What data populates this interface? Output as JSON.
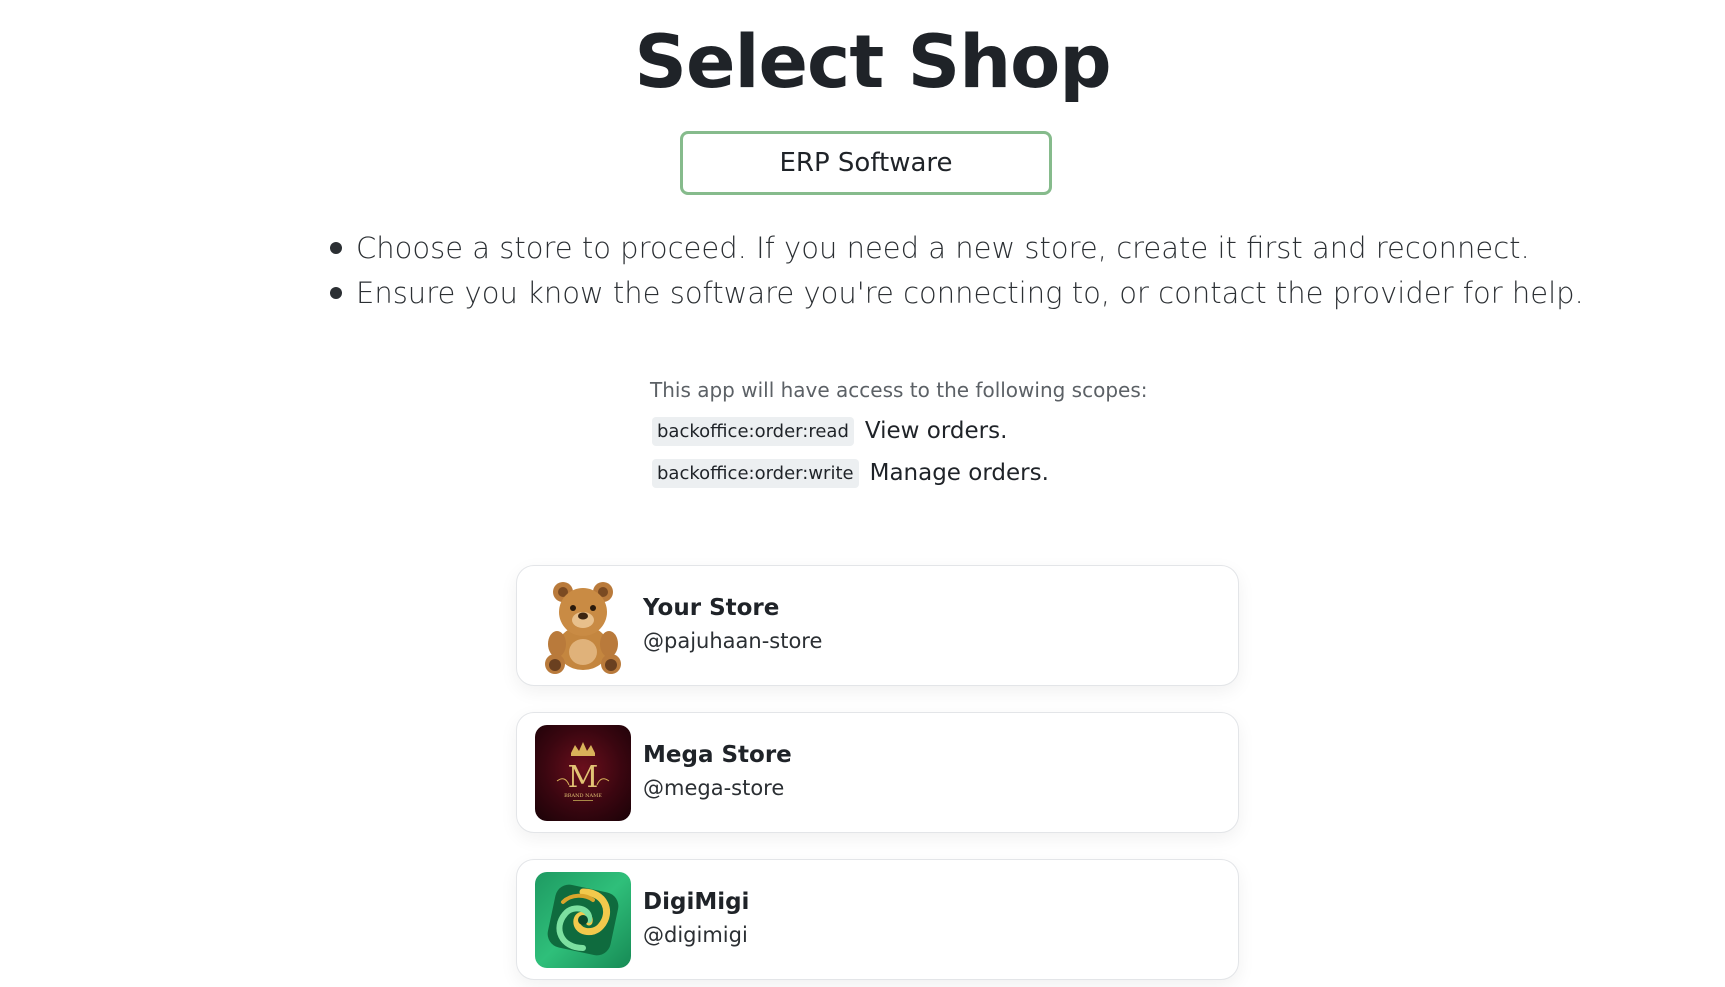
{
  "page": {
    "title": "Select Shop",
    "app_name": "ERP Software"
  },
  "notes": [
    "Choose a store to proceed. If you need a new store, create it first and reconnect.",
    "Ensure you know the software you're connecting to, or contact the provider for help."
  ],
  "scopes": {
    "intro": "This app will have access to the following scopes:",
    "items": [
      {
        "code": "backoffice:order:read",
        "description": "View orders."
      },
      {
        "code": "backoffice:order:write",
        "description": "Manage orders."
      }
    ]
  },
  "stores": [
    {
      "name": "Your Store",
      "handle": "@pajuhaan-store",
      "avatar": "teddy-bear-icon"
    },
    {
      "name": "Mega Store",
      "handle": "@mega-store",
      "avatar": "crown-m-logo",
      "logo_text": "BRAND NAME"
    },
    {
      "name": "DigiMigi",
      "handle": "@digimigi",
      "avatar": "green-swirl-logo"
    }
  ],
  "colors": {
    "badge_border": "#86bb8c",
    "text": "#1f2328",
    "scope_bg": "#eceff1"
  }
}
